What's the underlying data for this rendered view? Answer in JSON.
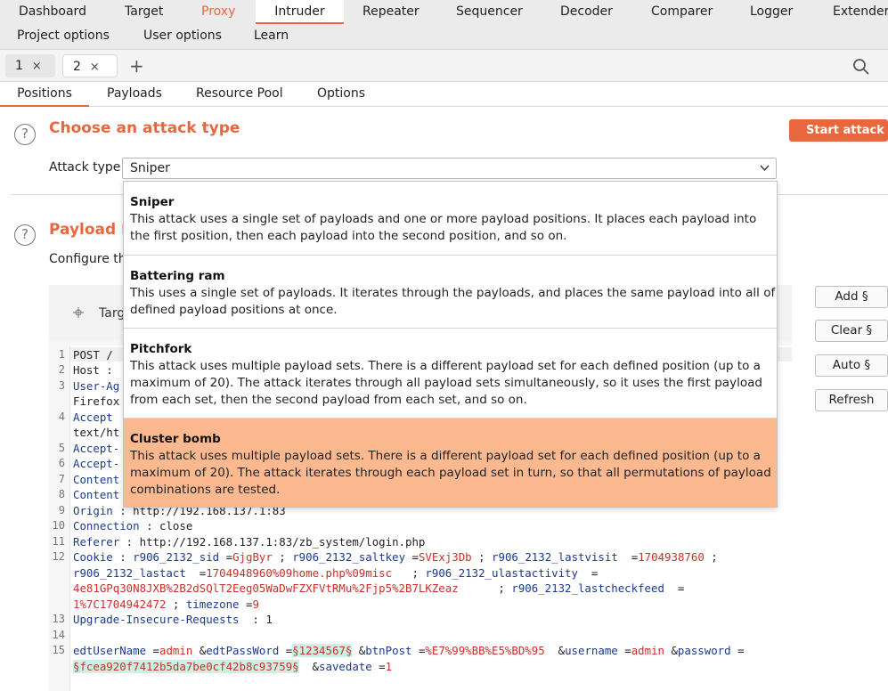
{
  "top_nav": {
    "row1": [
      "Dashboard",
      "Target",
      "Proxy",
      "Intruder",
      "Repeater",
      "Sequencer",
      "Decoder",
      "Comparer",
      "Logger",
      "Extender"
    ],
    "row2": [
      "Project options",
      "User options",
      "Learn"
    ],
    "active": "Intruder",
    "highlight": "Proxy"
  },
  "attack_tabs": [
    {
      "label": "1",
      "close": "×"
    },
    {
      "label": "2",
      "close": "×"
    }
  ],
  "add_tab": "+",
  "sub_tabs": [
    "Positions",
    "Payloads",
    "Resource Pool",
    "Options"
  ],
  "attack_section": {
    "title": "Choose an attack type",
    "start_label": "Start attack",
    "type_label": "Attack type:",
    "selected": "Sniper"
  },
  "payload_section": {
    "title": "Payload P",
    "desc": "Configure th",
    "target_label": "Targ"
  },
  "dropdown_options": [
    {
      "title": "Sniper",
      "lines": [
        "This attack uses a single set of payloads and one or more payload positions. It places each payload into",
        "the first position, then each payload into the second position, and so on."
      ]
    },
    {
      "title": "Battering ram",
      "lines": [
        "This uses a single set of payloads. It iterates through the payloads, and places the same payload into all of t",
        "defined payload positions at once."
      ]
    },
    {
      "title": "Pitchfork",
      "lines": [
        "This attack uses multiple payload sets. There is a different payload set for each defined position (up to a",
        "maximum of 20). The attack iterates through all payload sets simultaneously, so it uses the first payload",
        "from each set, then the second payload from each set, and so on."
      ]
    },
    {
      "title": "Cluster bomb",
      "lines": [
        "This attack uses multiple payload sets. There is a different payload set for each defined position (up to a",
        "maximum of 20). The attack iterates through each payload set in turn, so that all permutations of payload",
        "combinations are tested."
      ]
    }
  ],
  "side_buttons": [
    "Add §",
    "Clear §",
    "Auto §",
    "Refresh"
  ],
  "editor": {
    "line_numbers": [
      "1",
      "2",
      "3",
      "",
      "4",
      "",
      "5",
      "6",
      "7",
      "8",
      "9",
      "10",
      "11",
      "12",
      "",
      "",
      "",
      "13",
      "14",
      "15"
    ],
    "lines_visible": {
      "l1": "POST /",
      "l2": "Host :",
      "l3a": "User-Ag",
      "l3b": "Firefox",
      "l4a": "Accept",
      "l4b": "text/ht",
      "l5": "Accept-",
      "l6": "Accept-",
      "l7": "Content",
      "l8": "Content",
      "origin_key": "Origin",
      "origin_val": "http://192.168.137.1:83",
      "conn_key": "Connection",
      "conn_val": "close",
      "ref_key": "Referer",
      "ref_val": "http://192.168.137.1:83/zb_system/login.php",
      "cookie_key": "Cookie",
      "c1k": "r906_2132_sid",
      "c1v": "GjgByr",
      "c2k": "r906_2132_saltkey",
      "c2v": "SVExj3Db",
      "c3k": "r906_2132_lastvisit",
      "c3v": "1704938760",
      "c4k": "r906_2132_lastact",
      "c4v": "1704948960%09home.php%09misc",
      "c5k": "r906_2132_ulastactivity",
      "c5v": "4e81GPq30N8JXB%2B2dSQlT2Eeg05WaDwFZXFVtRMu%2Fjp5%2B7LKZeaz",
      "c6k": "r906_2132_lastcheckfeed",
      "c6v": "1%7C1704942472",
      "c7k": "timezone",
      "c7v": "9",
      "uir_key": "Upgrade-Insecure-Requests",
      "uir_val": "1",
      "b1k": "edtUserName",
      "b1v": "admin",
      "b2k": "edtPassWord",
      "b2v": "§1234567§",
      "b3k": "btnPost",
      "b3v": "%E7%99%BB%E5%BD%95",
      "b4k": "username",
      "b4v": "admin",
      "b5k": "password",
      "b5v": "§fcea920f7412b5da7be0cf42b8c93759§",
      "b6k": "savedate",
      "b6v": "1"
    }
  }
}
